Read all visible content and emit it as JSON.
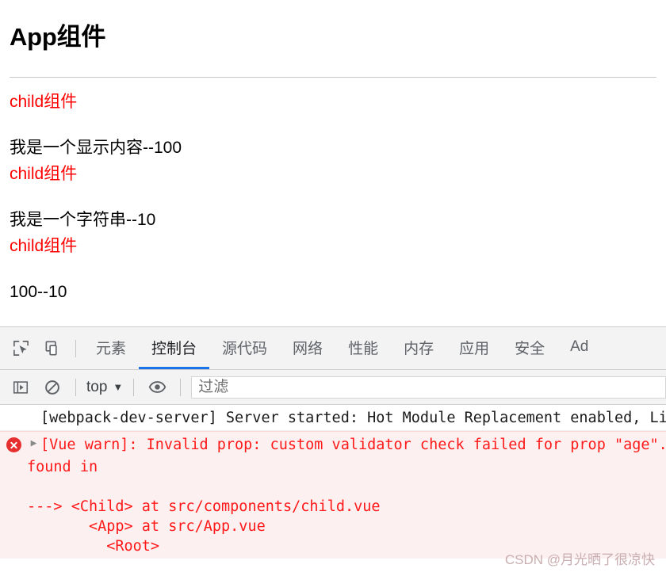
{
  "page": {
    "title": "App组件",
    "blocks": [
      {
        "child_label": "child组件",
        "content": "我是一个显示内容--100"
      },
      {
        "child_label": "child组件",
        "content": "我是一个字符串--10"
      },
      {
        "child_label": "child组件",
        "content": "100--10"
      }
    ]
  },
  "devtools": {
    "toolbar_icons": [
      {
        "name": "inspect-element-icon",
        "title": "选择元素"
      },
      {
        "name": "device-toolbar-icon",
        "title": "切换设备工具栏"
      }
    ],
    "tabs": [
      {
        "label": "元素",
        "active": false
      },
      {
        "label": "控制台",
        "active": true
      },
      {
        "label": "源代码",
        "active": false
      },
      {
        "label": "网络",
        "active": false
      },
      {
        "label": "性能",
        "active": false
      },
      {
        "label": "内存",
        "active": false
      },
      {
        "label": "应用",
        "active": false
      },
      {
        "label": "安全",
        "active": false
      },
      {
        "label": "Ad",
        "active": false
      }
    ],
    "console_toolbar": {
      "sidebar_icon": "console-sidebar-icon",
      "clear_icon": "clear-console-icon",
      "context": "top",
      "context_caret": "▼",
      "eye_icon": "live-expression-eye-icon",
      "filter_placeholder": "过滤"
    },
    "messages": [
      {
        "level": "info",
        "icon": "",
        "expandable": false,
        "text": "[webpack-dev-server] Server started: Hot Module Replacement enabled, Live"
      },
      {
        "level": "error",
        "icon": "error-circle-icon",
        "expandable": true,
        "arrow": "▶",
        "text": "[Vue warn]: Invalid prop: custom validator check failed for prop \"age\"."
      }
    ],
    "trace": [
      "found in",
      "",
      "---> <Child> at src/components/child.vue",
      "       <App> at src/App.vue",
      "         <Root>"
    ]
  },
  "watermark": "CSDN @月光晒了很凉快",
  "colors": {
    "accent": "#1a73e8",
    "error_text": "#ff1919",
    "error_bg": "#fdf0f0",
    "child_red": "#ff0000"
  }
}
